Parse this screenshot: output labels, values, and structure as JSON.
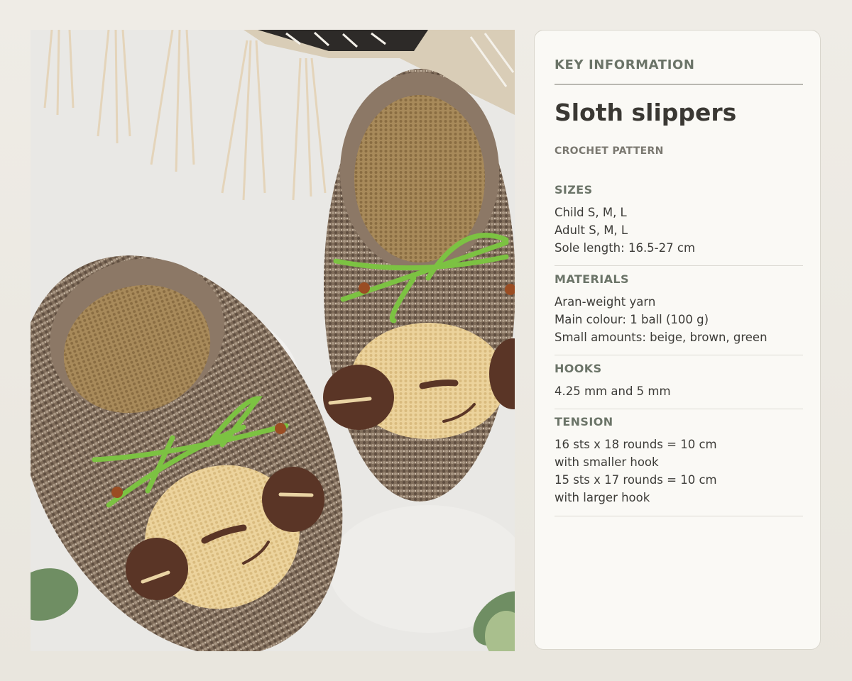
{
  "card": {
    "kicker": "KEY INFORMATION",
    "title": "Sloth slippers",
    "subtitle": "CROCHET PATTERN",
    "sections": [
      {
        "heading": "SIZES",
        "lines": [
          "Child S, M, L",
          "Adult S, M, L",
          "Sole length: 16.5-27 cm"
        ]
      },
      {
        "heading": "MATERIALS",
        "lines": [
          "Aran-weight yarn",
          "Main colour: 1 ball (100 g)",
          "Small amounts: beige, brown, green"
        ]
      },
      {
        "heading": "HOOKS",
        "lines": [
          "4.25 mm and 5 mm"
        ]
      },
      {
        "heading": "TENSION",
        "lines": [
          "16 sts x 18 rounds = 10 cm",
          "with smaller hook",
          "15 sts x 17 rounds = 10 cm",
          "with larger hook"
        ]
      }
    ]
  },
  "colors": {
    "accent": "#6b7468",
    "yarn_brown": "#7d6a58",
    "yarn_beige": "#e9cf97",
    "yarn_dark": "#5a3a2a",
    "ribbon_green": "#7cc242"
  }
}
